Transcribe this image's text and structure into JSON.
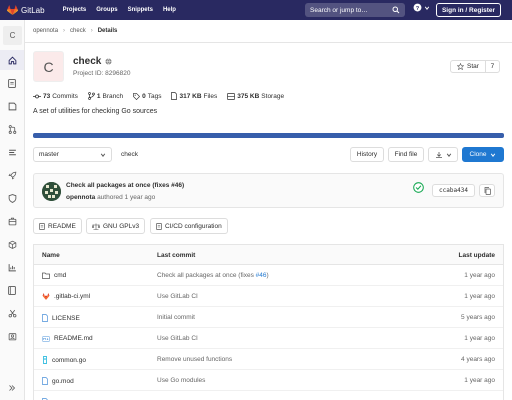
{
  "navbar": {
    "brand": "GitLab",
    "links": [
      "Projects",
      "Groups",
      "Snippets",
      "Help"
    ],
    "search_placeholder": "Search or jump to…",
    "sign_in": "Sign in / Register"
  },
  "sidebar": {
    "project_letter": "C",
    "icons": [
      "home-icon",
      "doc-icon",
      "issues-icon",
      "merge-request-icon",
      "list-icon",
      "rocket-icon",
      "shield-icon",
      "package-icon",
      "chart-icon",
      "wiki-icon",
      "scissors-icon",
      "users-icon"
    ]
  },
  "breadcrumb": {
    "group": "opennota",
    "project": "check",
    "current": "Details"
  },
  "project": {
    "letter": "C",
    "name": "check",
    "id_text": "Project ID: 8296820",
    "star_label": "Star",
    "star_count": "7",
    "description": "A set of utilities for checking Go sources"
  },
  "stats": [
    {
      "value": "73",
      "label": "Commits"
    },
    {
      "value": "1",
      "label": "Branch"
    },
    {
      "value": "0",
      "label": "Tags"
    },
    {
      "value": "317 KB",
      "label": "Files"
    },
    {
      "value": "375 KB",
      "label": "Storage"
    }
  ],
  "controls": {
    "branch": "master",
    "path": "check",
    "history": "History",
    "find_file": "Find file",
    "clone": "Clone"
  },
  "commit": {
    "message": "Check all packages at once (fixes #46)",
    "author": "opennota",
    "authored": "authored",
    "time": "1 year ago",
    "sha": "ccaba434"
  },
  "quick_links": [
    "README",
    "GNU GPLv3",
    "CI/CD configuration"
  ],
  "table": {
    "headers": {
      "name": "Name",
      "last_commit": "Last commit",
      "last_update": "Last update"
    },
    "rows": [
      {
        "name": "cmd",
        "icon": "folder-icon",
        "commit": "Check all packages at once (fixes ",
        "commit_link": "#46",
        "commit_tail": ")",
        "update": "1 year ago"
      },
      {
        "name": ".gitlab-ci.yml",
        "icon": "gitlab-file-icon",
        "commit": "Use GitLab CI",
        "commit_link": "",
        "commit_tail": "",
        "update": "1 year ago"
      },
      {
        "name": "LICENSE",
        "icon": "file-icon",
        "commit": "Initial commit",
        "commit_link": "",
        "commit_tail": "",
        "update": "5 years ago"
      },
      {
        "name": "README.md",
        "icon": "markdown-file-icon",
        "commit": "Use GitLab CI",
        "commit_link": "",
        "commit_tail": "",
        "update": "1 year ago"
      },
      {
        "name": "common.go",
        "icon": "go-file-icon",
        "commit": "Remove unused functions",
        "commit_link": "",
        "commit_tail": "",
        "update": "4 years ago"
      },
      {
        "name": "go.mod",
        "icon": "file-icon",
        "commit": "Use Go modules",
        "commit_link": "",
        "commit_tail": "",
        "update": "1 year ago"
      }
    ]
  },
  "colors": {
    "navbar": "#292961",
    "accent": "#1f78d1",
    "language_bar": "#375eab",
    "success": "#1aaa55"
  }
}
